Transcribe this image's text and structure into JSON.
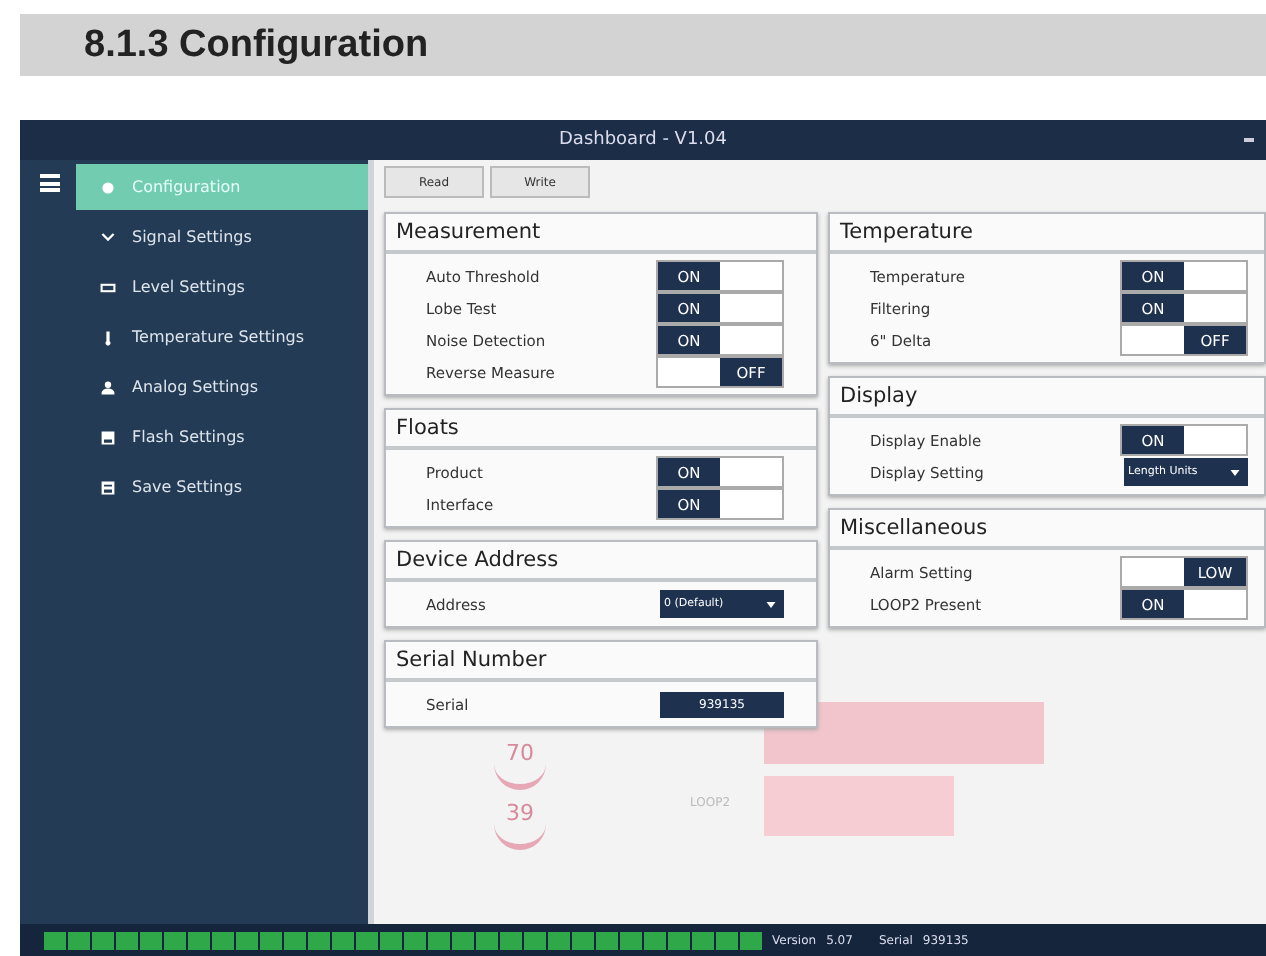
{
  "heading": "8.1.3 Configuration",
  "window": {
    "title": "Dashboard - V1.04"
  },
  "sidebar": {
    "items": [
      {
        "label": "Configuration",
        "selected": true
      },
      {
        "label": "Signal Settings",
        "selected": false
      },
      {
        "label": "Level Settings",
        "selected": false
      },
      {
        "label": "Temperature Settings",
        "selected": false
      },
      {
        "label": "Analog Settings",
        "selected": false
      },
      {
        "label": "Flash Settings",
        "selected": false
      },
      {
        "label": "Save Settings",
        "selected": false
      }
    ]
  },
  "toolbar": {
    "buttons": [
      "Read",
      "Write"
    ]
  },
  "background": {
    "gauges": [
      "70",
      "39"
    ],
    "bar_label": "LOOP2"
  },
  "left_panels": [
    {
      "title": "Measurement",
      "rows": [
        {
          "kind": "toggle",
          "label": "Auto Threshold",
          "on": true,
          "state": "ON"
        },
        {
          "kind": "toggle",
          "label": "Lobe Test",
          "on": true,
          "state": "ON"
        },
        {
          "kind": "toggle",
          "label": "Noise Detection",
          "on": true,
          "state": "ON"
        },
        {
          "kind": "toggle",
          "label": "Reverse Measure",
          "on": false,
          "state": "OFF"
        }
      ]
    },
    {
      "title": "Floats",
      "rows": [
        {
          "kind": "toggle",
          "label": "Product",
          "on": true,
          "state": "ON"
        },
        {
          "kind": "toggle",
          "label": "Interface",
          "on": true,
          "state": "ON"
        }
      ]
    },
    {
      "title": "Device Address",
      "rows": [
        {
          "kind": "select",
          "label": "Address",
          "value": "0 (Default)"
        }
      ]
    },
    {
      "title": "Serial Number",
      "rows": [
        {
          "kind": "value",
          "label": "Serial",
          "value": "939135"
        }
      ]
    }
  ],
  "right_panels": [
    {
      "title": "Temperature",
      "rows": [
        {
          "kind": "toggle",
          "label": "Temperature",
          "on": true,
          "state": "ON"
        },
        {
          "kind": "toggle",
          "label": "Filtering",
          "on": true,
          "state": "ON"
        },
        {
          "kind": "toggle",
          "label": "6\" Delta",
          "on": false,
          "state": "OFF"
        }
      ]
    },
    {
      "title": "Display",
      "rows": [
        {
          "kind": "toggle",
          "label": "Display Enable",
          "on": true,
          "state": "ON"
        },
        {
          "kind": "select",
          "label": "Display Setting",
          "value": "Length Units"
        }
      ]
    },
    {
      "title": "Miscellaneous",
      "rows": [
        {
          "kind": "toggle",
          "label": "Alarm Setting",
          "on": false,
          "state": "LOW"
        },
        {
          "kind": "toggle",
          "label": "LOOP2 Present",
          "on": true,
          "state": "ON"
        }
      ]
    }
  ],
  "status_bar": {
    "indicators": [
      {
        "on": true
      },
      {
        "on": true
      },
      {
        "on": true
      },
      {
        "on": true
      },
      {
        "on": true
      },
      {
        "on": true
      },
      {
        "on": true
      },
      {
        "on": true
      },
      {
        "on": true
      },
      {
        "on": true
      },
      {
        "on": true
      },
      {
        "on": true
      },
      {
        "on": true
      },
      {
        "on": true
      },
      {
        "on": true
      },
      {
        "on": true
      },
      {
        "on": true
      },
      {
        "on": true
      },
      {
        "on": true
      },
      {
        "on": true
      },
      {
        "on": true
      },
      {
        "on": true
      },
      {
        "on": true
      },
      {
        "on": true
      },
      {
        "on": true
      },
      {
        "on": true
      },
      {
        "on": true
      },
      {
        "on": true
      },
      {
        "on": true
      },
      {
        "on": true
      }
    ],
    "version_label": "Version",
    "version": "5.07",
    "serial_label": "Serial",
    "serial": "939135"
  }
}
